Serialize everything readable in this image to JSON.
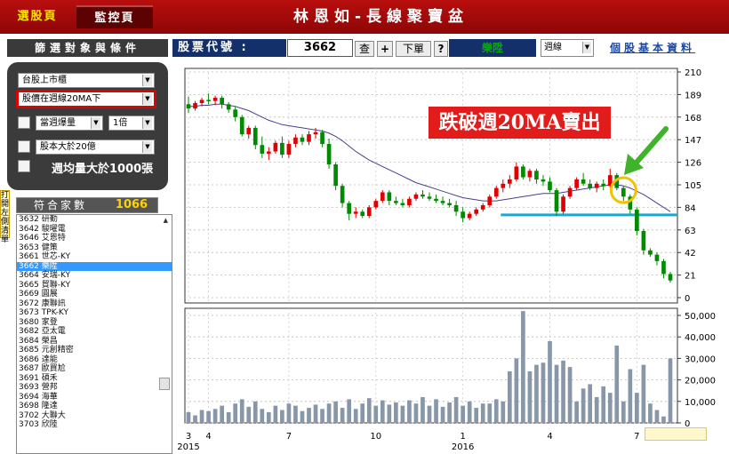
{
  "tabs": {
    "select": "選股頁",
    "monitor": "監控頁"
  },
  "app_title": "林恩如-長線聚寶盆",
  "left_panel": {
    "header": "篩選對象與條件",
    "market_select": "台股上市櫃",
    "condition_select": "股價在週線20MA下",
    "volume_label": "當週爆量",
    "volume_multiple": "1倍",
    "capital_select": "股本大於20億",
    "avg_volume_label": "週均量大於1000張",
    "match_label": "符合家數",
    "match_count": "1066",
    "side_tab": "打開左側清單",
    "stocks": [
      {
        "code": "3632",
        "name": "研勤"
      },
      {
        "code": "3642",
        "name": "駿曜電"
      },
      {
        "code": "3646",
        "name": "艾恩特"
      },
      {
        "code": "3653",
        "name": "健策"
      },
      {
        "code": "3661",
        "name": "世芯-KY"
      },
      {
        "code": "3662",
        "name": "樂陞"
      },
      {
        "code": "3664",
        "name": "安瑞-KY"
      },
      {
        "code": "3665",
        "name": "貿聯-KY"
      },
      {
        "code": "3669",
        "name": "圓展"
      },
      {
        "code": "3672",
        "name": "康聯訊"
      },
      {
        "code": "3673",
        "name": "TPK-KY"
      },
      {
        "code": "3680",
        "name": "家登"
      },
      {
        "code": "3682",
        "name": "亞太電"
      },
      {
        "code": "3684",
        "name": "榮昌"
      },
      {
        "code": "3685",
        "name": "元創精密"
      },
      {
        "code": "3686",
        "name": "達能"
      },
      {
        "code": "3687",
        "name": "歐買尬"
      },
      {
        "code": "3691",
        "name": "碩禾"
      },
      {
        "code": "3693",
        "name": "營邦"
      },
      {
        "code": "3694",
        "name": "海華"
      },
      {
        "code": "3698",
        "name": "隆達"
      },
      {
        "code": "3702",
        "name": "大聯大"
      },
      {
        "code": "3703",
        "name": "欣陸"
      }
    ],
    "selected_code": "3662"
  },
  "header": {
    "code_label": "股票代號 :",
    "code_value": "3662",
    "query_btn": "查",
    "add_btn": "+",
    "order_btn": "下單",
    "help_btn": "?",
    "stock_name": "樂陞",
    "period": "週線",
    "basic_info_link": "個股基本資料"
  },
  "annotation": "跌破週20MA賣出",
  "chart_data": {
    "type": "candlestick",
    "price_axis": {
      "ylim": [
        0,
        210
      ],
      "ticks": [
        0,
        21,
        42,
        63,
        84,
        105,
        126,
        147,
        168,
        189,
        210
      ]
    },
    "volume_axis": {
      "ylim": [
        0,
        50000
      ],
      "ticks": [
        "0",
        "10,000",
        "20,000",
        "30,000",
        "40,000",
        "50,000"
      ]
    },
    "x_ticks": [
      {
        "label": "3",
        "week": 0
      },
      {
        "label": "4",
        "week": 3
      },
      {
        "label": "7",
        "week": 15
      },
      {
        "label": "10",
        "week": 28
      },
      {
        "label": "1",
        "week": 41
      },
      {
        "label": "4",
        "week": 54
      },
      {
        "label": "7",
        "week": 67
      }
    ],
    "year_labels": [
      {
        "label": "2015",
        "week": 0
      },
      {
        "label": "2016",
        "week": 41
      }
    ],
    "support_level": 77,
    "ohlc": [
      [
        180,
        187,
        172,
        176
      ],
      [
        176,
        183,
        174,
        181
      ],
      [
        181,
        186,
        178,
        184
      ],
      [
        184,
        190,
        180,
        183
      ],
      [
        183,
        188,
        179,
        186
      ],
      [
        186,
        188,
        176,
        180
      ],
      [
        180,
        182,
        172,
        175
      ],
      [
        175,
        178,
        164,
        168
      ],
      [
        168,
        170,
        150,
        152
      ],
      [
        152,
        160,
        148,
        158
      ],
      [
        158,
        160,
        138,
        142
      ],
      [
        142,
        150,
        130,
        134
      ],
      [
        134,
        140,
        128,
        136
      ],
      [
        136,
        146,
        134,
        144
      ],
      [
        144,
        150,
        130,
        133
      ],
      [
        133,
        146,
        130,
        143
      ],
      [
        143,
        152,
        140,
        149
      ],
      [
        149,
        152,
        142,
        145
      ],
      [
        145,
        155,
        142,
        152
      ],
      [
        152,
        158,
        148,
        154
      ],
      [
        154,
        156,
        140,
        143
      ],
      [
        143,
        148,
        120,
        124
      ],
      [
        124,
        126,
        100,
        104
      ],
      [
        104,
        106,
        84,
        88
      ],
      [
        88,
        90,
        72,
        78
      ],
      [
        78,
        84,
        74,
        80
      ],
      [
        80,
        82,
        74,
        76
      ],
      [
        76,
        86,
        74,
        84
      ],
      [
        84,
        92,
        82,
        90
      ],
      [
        90,
        100,
        88,
        98
      ],
      [
        98,
        100,
        86,
        90
      ],
      [
        90,
        94,
        86,
        88
      ],
      [
        88,
        92,
        84,
        86
      ],
      [
        86,
        94,
        84,
        92
      ],
      [
        92,
        98,
        90,
        96
      ],
      [
        96,
        100,
        92,
        94
      ],
      [
        94,
        98,
        90,
        92
      ],
      [
        92,
        96,
        88,
        90
      ],
      [
        90,
        94,
        86,
        88
      ],
      [
        88,
        92,
        84,
        86
      ],
      [
        86,
        90,
        76,
        80
      ],
      [
        80,
        84,
        70,
        74
      ],
      [
        74,
        80,
        72,
        78
      ],
      [
        78,
        84,
        76,
        82
      ],
      [
        82,
        88,
        80,
        86
      ],
      [
        86,
        96,
        84,
        94
      ],
      [
        94,
        104,
        92,
        102
      ],
      [
        102,
        110,
        98,
        106
      ],
      [
        106,
        114,
        102,
        110
      ],
      [
        110,
        126,
        108,
        122
      ],
      [
        122,
        124,
        110,
        112
      ],
      [
        112,
        120,
        108,
        118
      ],
      [
        118,
        120,
        106,
        110
      ],
      [
        110,
        114,
        104,
        108
      ],
      [
        108,
        112,
        98,
        100
      ],
      [
        100,
        102,
        76,
        80
      ],
      [
        80,
        96,
        78,
        94
      ],
      [
        94,
        104,
        92,
        102
      ],
      [
        102,
        112,
        100,
        110
      ],
      [
        110,
        116,
        104,
        106
      ],
      [
        106,
        110,
        100,
        102
      ],
      [
        102,
        108,
        98,
        106
      ],
      [
        106,
        110,
        100,
        104
      ],
      [
        104,
        120,
        102,
        114
      ],
      [
        114,
        116,
        100,
        102
      ],
      [
        102,
        104,
        90,
        94
      ],
      [
        94,
        96,
        78,
        82
      ],
      [
        82,
        84,
        58,
        62
      ],
      [
        62,
        64,
        40,
        44
      ],
      [
        44,
        46,
        38,
        40
      ],
      [
        40,
        42,
        30,
        34
      ],
      [
        34,
        36,
        18,
        22
      ],
      [
        22,
        24,
        14,
        16
      ]
    ],
    "ma20": [
      178,
      178,
      179,
      179,
      180,
      180,
      179,
      178,
      176,
      174,
      171,
      168,
      165,
      163,
      161,
      160,
      159,
      158,
      157,
      156,
      155,
      153,
      150,
      146,
      141,
      136,
      132,
      128,
      125,
      122,
      119,
      116,
      113,
      110,
      107,
      105,
      103,
      101,
      99,
      97,
      95,
      93,
      92,
      91,
      90,
      90,
      90,
      91,
      92,
      93,
      94,
      95,
      96,
      97,
      97,
      97,
      98,
      99,
      100,
      101,
      102,
      103,
      104,
      105,
      105,
      104,
      102,
      99,
      96,
      92,
      88,
      84,
      80
    ],
    "volume": [
      5000,
      3500,
      6000,
      5500,
      6500,
      8000,
      5000,
      9000,
      11000,
      7500,
      10000,
      6500,
      5000,
      8000,
      6000,
      9000,
      8000,
      5500,
      7000,
      8500,
      6500,
      9000,
      10000,
      7000,
      11000,
      6500,
      9000,
      11500,
      8000,
      10500,
      8500,
      9500,
      8000,
      10500,
      9000,
      12000,
      8000,
      11000,
      7500,
      9500,
      12000,
      8000,
      10000,
      7000,
      9000,
      9000,
      11000,
      10000,
      24000,
      30000,
      52000,
      24000,
      27000,
      28000,
      38000,
      27000,
      29000,
      26000,
      10000,
      16000,
      18000,
      12000,
      17000,
      14000,
      36000,
      10000,
      25000,
      14000,
      27000,
      9000,
      6000,
      3000,
      30000
    ]
  }
}
